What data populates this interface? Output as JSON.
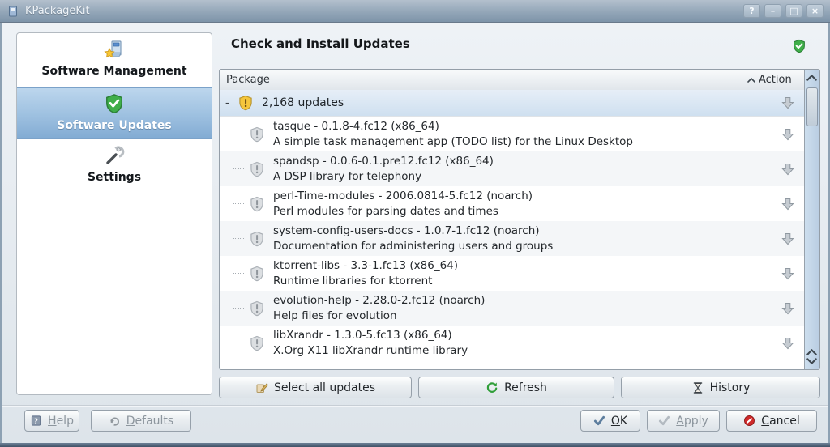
{
  "window": {
    "title": "KPackageKit",
    "controls": {
      "help": "?",
      "minimize": "–",
      "maximize": "□",
      "close": "×"
    }
  },
  "sidebar": {
    "items": [
      {
        "label": "Software Management"
      },
      {
        "label": "Software Updates"
      },
      {
        "label": "Settings"
      }
    ]
  },
  "page": {
    "title": "Check and Install Updates"
  },
  "list": {
    "columns": {
      "package": "Package",
      "action": "Action"
    },
    "root": {
      "expander": "-",
      "label": "2,168 updates"
    },
    "packages": [
      {
        "name": "tasque - 0.1.8-4.fc12 (x86_64)",
        "desc": "A simple task management app (TODO list) for the Linux Desktop"
      },
      {
        "name": "spandsp - 0.0.6-0.1.pre12.fc12 (x86_64)",
        "desc": "A DSP library for telephony"
      },
      {
        "name": "perl-Time-modules - 2006.0814-5.fc12 (noarch)",
        "desc": "Perl modules for parsing dates and times"
      },
      {
        "name": "system-config-users-docs - 1.0.7-1.fc12 (noarch)",
        "desc": "Documentation for administering users and groups"
      },
      {
        "name": "ktorrent-libs - 3.3-1.fc13 (x86_64)",
        "desc": "Runtime libraries for ktorrent"
      },
      {
        "name": "evolution-help - 2.28.0-2.fc12 (noarch)",
        "desc": "Help files for evolution"
      },
      {
        "name": "libXrandr - 1.3.0-5.fc13 (x86_64)",
        "desc": "X.Org X11 libXrandr runtime library"
      }
    ]
  },
  "toolbar": {
    "select_all": "Select all updates",
    "refresh": "Refresh",
    "history": "History"
  },
  "footer": {
    "help": {
      "accel": "H",
      "rest": "elp"
    },
    "defaults": {
      "accel": "D",
      "rest": "efaults"
    },
    "ok": {
      "accel": "O",
      "rest": "K"
    },
    "apply": {
      "accel": "A",
      "rest": "pply"
    },
    "cancel": {
      "accel": "C",
      "rest": "ancel"
    }
  },
  "colors": {
    "selection_top": "#bcd6ed",
    "selection_bottom": "#82abd3",
    "warning": "#f5c63c",
    "success": "#3fae49",
    "danger": "#cf2a2a",
    "titlebar_top": "#b3c0cd",
    "titlebar_bottom": "#7e94a9"
  }
}
